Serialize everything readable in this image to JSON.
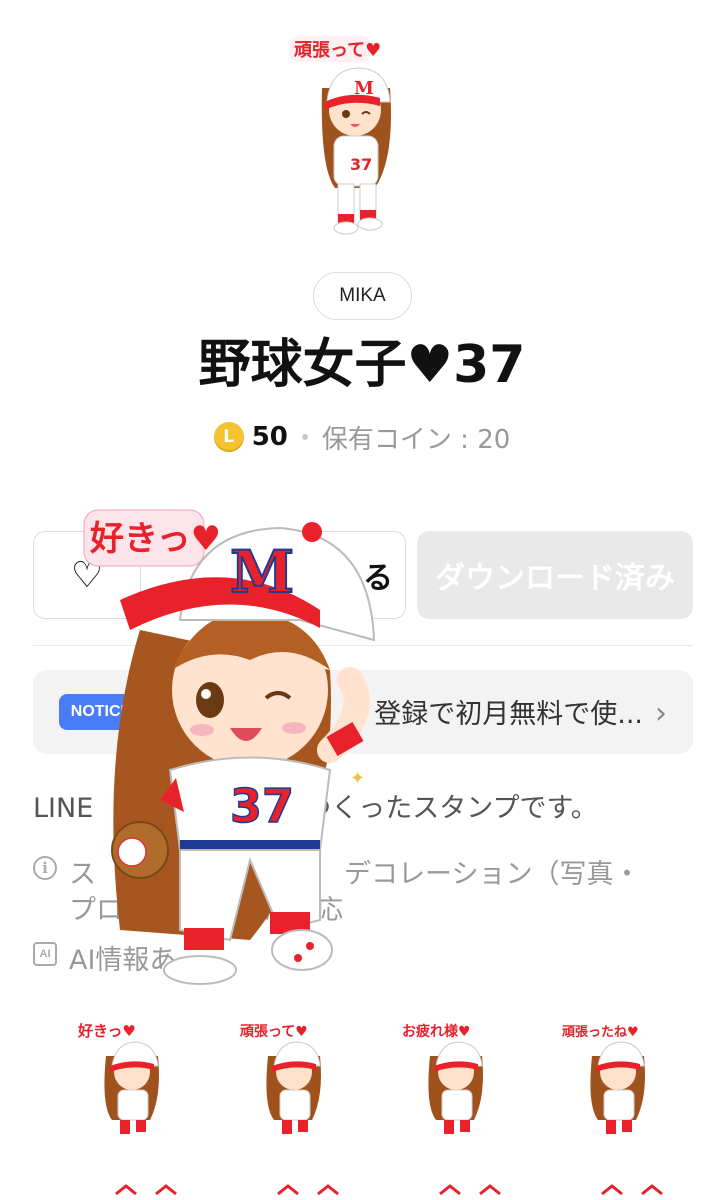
{
  "hero": {
    "sticker_caption": "頑張って♥"
  },
  "creator": "MIKA",
  "title": "野球女子♥37",
  "price": {
    "coin_symbol": "L",
    "amount": "50",
    "held_label": "保有コイン : 20"
  },
  "buttons": {
    "favorite": "♡",
    "gift_partial": "る",
    "download": "ダウンロード済み"
  },
  "notice": {
    "badge": "NOTICE",
    "text": "登録で初月無料で使...",
    "chevron": "›"
  },
  "description": {
    "prefix": "LINE",
    "suffix": "でつくったスタンプです。"
  },
  "deco": {
    "icon": "i",
    "line1a": "ス",
    "line1b": "デコレーション（写真・",
    "line2a": "プロフ",
    "line2b": "に対応"
  },
  "ai": {
    "icon": "AI",
    "text": "AI情報あ"
  },
  "preview": {
    "caption": "好きっ♥"
  },
  "grid": [
    {
      "caption": "好きっ♥"
    },
    {
      "caption": "頑張って♥"
    },
    {
      "caption": "お疲れ様♥"
    },
    {
      "caption": "頑張ったね♥"
    }
  ],
  "icons": {
    "heart": "heart-outline-icon",
    "chevron": "chevron-right-icon",
    "info": "info-circle-icon",
    "ai": "ai-badge-icon",
    "coin": "line-coin-icon"
  },
  "colors": {
    "accent_blue": "#4a7cf6",
    "coin": "#f4c430",
    "cap_red": "#e8212b",
    "navy": "#1f3a93"
  }
}
